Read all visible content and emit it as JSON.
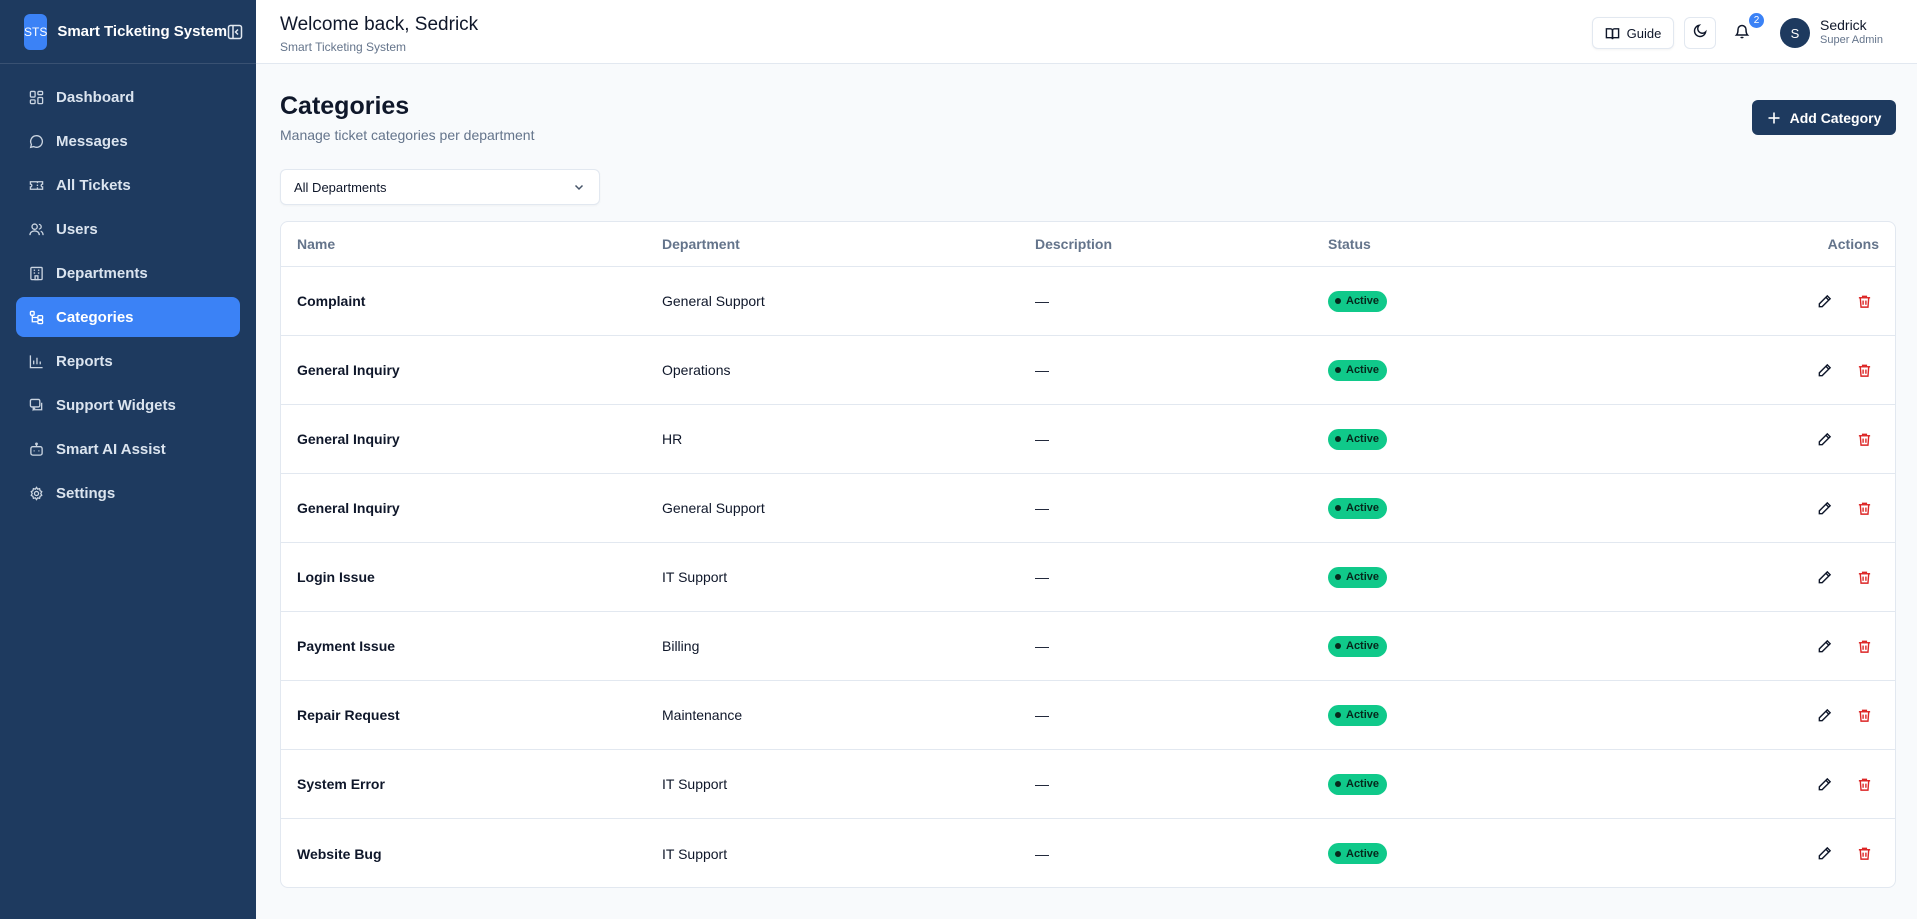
{
  "sidebar": {
    "logo": "STS",
    "brand": "Smart Ticketing System",
    "items": [
      {
        "label": "Dashboard",
        "icon": "dashboard-icon"
      },
      {
        "label": "Messages",
        "icon": "message-icon"
      },
      {
        "label": "All Tickets",
        "icon": "ticket-icon"
      },
      {
        "label": "Users",
        "icon": "users-icon"
      },
      {
        "label": "Departments",
        "icon": "building-icon"
      },
      {
        "label": "Categories",
        "icon": "categories-icon",
        "active": true
      },
      {
        "label": "Reports",
        "icon": "chart-icon"
      },
      {
        "label": "Support Widgets",
        "icon": "widget-icon"
      },
      {
        "label": "Smart AI Assist",
        "icon": "bot-icon"
      },
      {
        "label": "Settings",
        "icon": "gear-icon"
      }
    ]
  },
  "header": {
    "welcome": "Welcome back, Sedrick",
    "subtitle": "Smart Ticketing System",
    "guide_label": "Guide",
    "notification_count": "2",
    "user_initial": "S",
    "user_name": "Sedrick",
    "user_role": "Super Admin"
  },
  "main": {
    "title": "Categories",
    "subtitle": "Manage ticket categories per department",
    "add_label": "Add Category",
    "filter_value": "All Departments",
    "columns": {
      "name": "Name",
      "department": "Department",
      "description": "Description",
      "status": "Status",
      "actions": "Actions"
    },
    "rows": [
      {
        "name": "Complaint",
        "department": "General Support",
        "description": "—",
        "status": "Active"
      },
      {
        "name": "General Inquiry",
        "department": "Operations",
        "description": "—",
        "status": "Active"
      },
      {
        "name": "General Inquiry",
        "department": "HR",
        "description": "—",
        "status": "Active"
      },
      {
        "name": "General Inquiry",
        "department": "General Support",
        "description": "—",
        "status": "Active"
      },
      {
        "name": "Login Issue",
        "department": "IT Support",
        "description": "—",
        "status": "Active"
      },
      {
        "name": "Payment Issue",
        "department": "Billing",
        "description": "—",
        "status": "Active"
      },
      {
        "name": "Repair Request",
        "department": "Maintenance",
        "description": "—",
        "status": "Active"
      },
      {
        "name": "System Error",
        "department": "IT Support",
        "description": "—",
        "status": "Active"
      },
      {
        "name": "Website Bug",
        "department": "IT Support",
        "description": "—",
        "status": "Active"
      }
    ]
  },
  "colors": {
    "sidebar_bg": "#1e3a5f",
    "accent": "#3b82f6",
    "status_active": "#10c98a",
    "danger": "#dc2626"
  }
}
